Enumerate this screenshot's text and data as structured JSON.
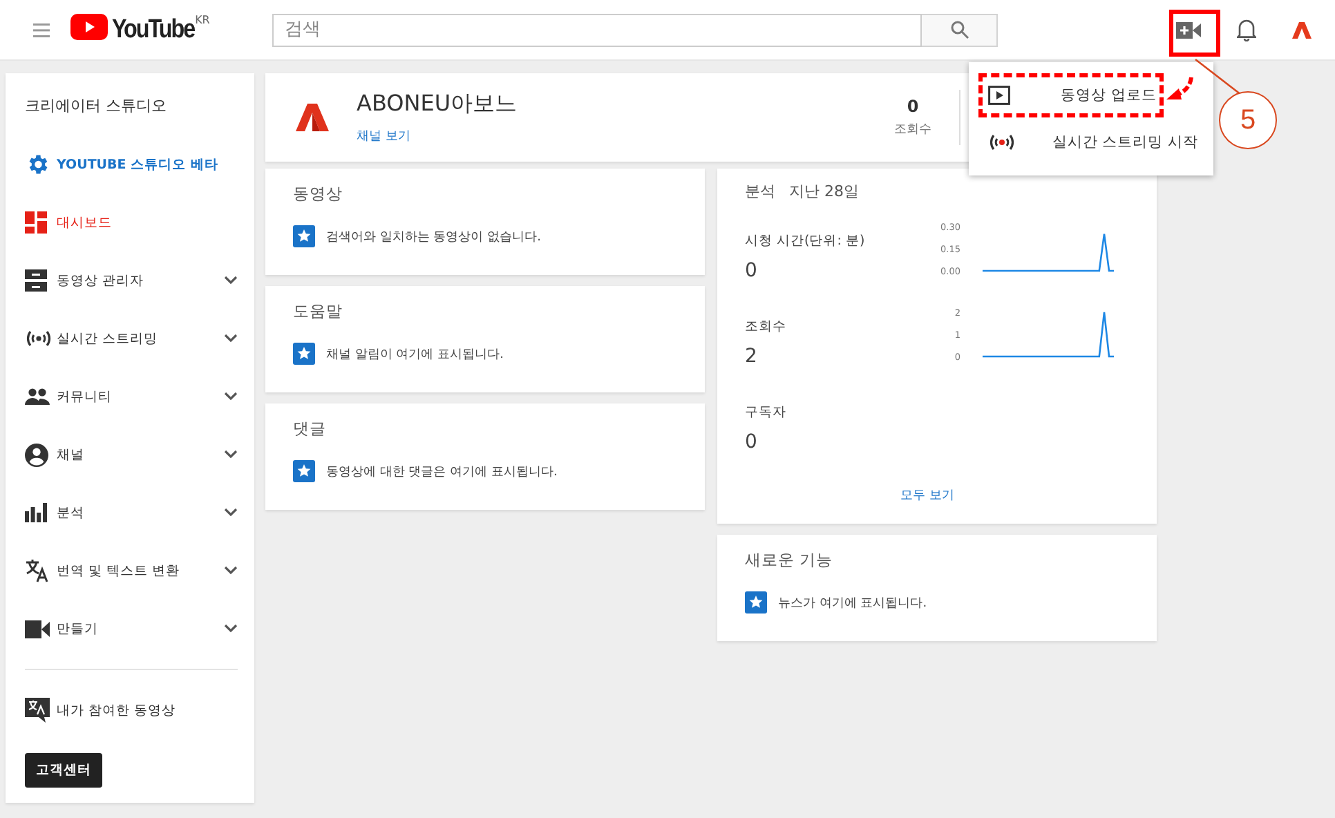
{
  "topbar": {
    "logo": "YouTube",
    "region": "KR",
    "search": {
      "placeholder": "검색"
    }
  },
  "sidebar": {
    "title": "크리에이터 스튜디오",
    "items": [
      {
        "label": "YOUTUBE 스튜디오 베타",
        "kind": "link",
        "selected": false
      },
      {
        "label": "대시보드",
        "kind": "page",
        "selected": true
      },
      {
        "label": "동영상 관리자",
        "kind": "section",
        "selected": false,
        "expanded": false
      },
      {
        "label": "실시간 스트리밍",
        "kind": "section",
        "selected": false,
        "expanded": false
      },
      {
        "label": "커뮤니티",
        "kind": "section",
        "selected": false,
        "expanded": false
      },
      {
        "label": "채널",
        "kind": "section",
        "selected": false,
        "expanded": false
      },
      {
        "label": "분석",
        "kind": "section",
        "selected": false,
        "expanded": false
      },
      {
        "label": "번역 및 텍스트 변환",
        "kind": "section",
        "selected": false,
        "expanded": false
      },
      {
        "label": "만들기",
        "kind": "section",
        "selected": false,
        "expanded": false
      }
    ],
    "footer_item": {
      "label": "내가 참여한 동영상"
    },
    "help_button": "고객센터"
  },
  "channel": {
    "name": "ABONEU아보느",
    "link": "채널 보기",
    "stats": [
      {
        "value": "0",
        "label": "조회수"
      }
    ]
  },
  "cards": [
    {
      "title": "동영상",
      "message": "검색어와 일치하는 동영상이 없습니다."
    },
    {
      "title": "도움말",
      "message": "채널 알림이 여기에 표시됩니다."
    },
    {
      "title": "댓글",
      "message": "동영상에 대한 댓글은 여기에 표시됩니다."
    }
  ],
  "analytics": {
    "title": "분석",
    "period": "지난 28일",
    "link": "모두 보기",
    "metrics": [
      {
        "label": "시청 시간(단위: 분)",
        "value": "0",
        "chart_data": {
          "type": "line",
          "ylim": [
            0,
            0.3
          ],
          "yticks": [
            {
              "value": 0,
              "label": "0.00"
            },
            {
              "value": 0.15,
              "label": "0.15"
            },
            {
              "value": 0.3,
              "label": "0.30"
            }
          ],
          "series": [
            {
              "color": "#1e88e5",
              "values": [
                0,
                0,
                0,
                0,
                0,
                0,
                0,
                0,
                0,
                0,
                0,
                0,
                0,
                0,
                0,
                0,
                0,
                0,
                0,
                0,
                0,
                0,
                0,
                0,
                0,
                0.25,
                0,
                0
              ]
            }
          ]
        }
      },
      {
        "label": "조회수",
        "value": "2",
        "chart_data": {
          "type": "line",
          "ylim": [
            0,
            2
          ],
          "yticks": [
            0,
            1,
            2
          ],
          "series": [
            {
              "color": "#1e88e5",
              "values": [
                0,
                0,
                0,
                0,
                0,
                0,
                0,
                0,
                0,
                0,
                0,
                0,
                0,
                0,
                0,
                0,
                0,
                0,
                0,
                0,
                0,
                0,
                0,
                0,
                0,
                2,
                0,
                0
              ]
            }
          ]
        }
      },
      {
        "label": "구독자",
        "value": "0"
      }
    ]
  },
  "news": {
    "title": "새로운 기능",
    "message": "뉴스가 여기에 표시됩니다."
  },
  "upload_menu": {
    "items": [
      {
        "label": "동영상 업로드",
        "highlighted": true
      },
      {
        "label": "실시간 스트리밍 시작",
        "highlighted": false
      }
    ]
  },
  "annotation": {
    "step": "5"
  }
}
